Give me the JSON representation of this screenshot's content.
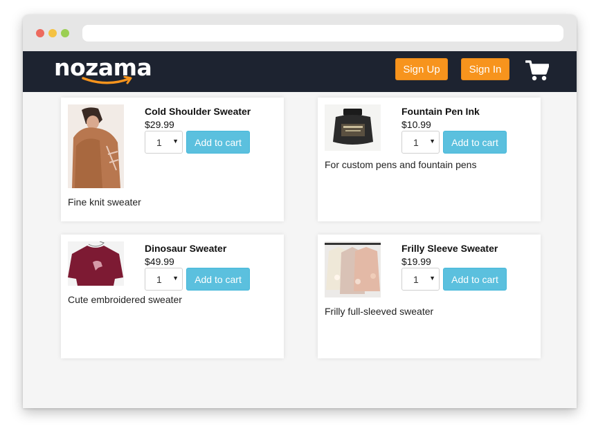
{
  "navbar": {
    "logo_text": "nozama",
    "signup_label": "Sign Up",
    "signin_label": "Sign In",
    "cart_icon": "shopping-cart-icon"
  },
  "colors": {
    "navbar": "#1d2330",
    "accent_orange": "#f7941d",
    "add_button": "#5bc0de"
  },
  "products": [
    {
      "title": "Cold Shoulder Sweater",
      "price": "$29.99",
      "quantity": "1",
      "button": "Add to cart",
      "description": "Fine knit sweater"
    },
    {
      "title": "Fountain Pen Ink",
      "price": "$10.99",
      "quantity": "1",
      "button": "Add to cart",
      "description": "For custom pens and fountain pens"
    },
    {
      "title": "Dinosaur Sweater",
      "price": "$49.99",
      "quantity": "1",
      "button": "Add to cart",
      "description": "Cute embroidered sweater"
    },
    {
      "title": "Frilly Sleeve Sweater",
      "price": "$19.99",
      "quantity": "1",
      "button": "Add to cart",
      "description": "Frilly full-sleeved sweater"
    }
  ]
}
